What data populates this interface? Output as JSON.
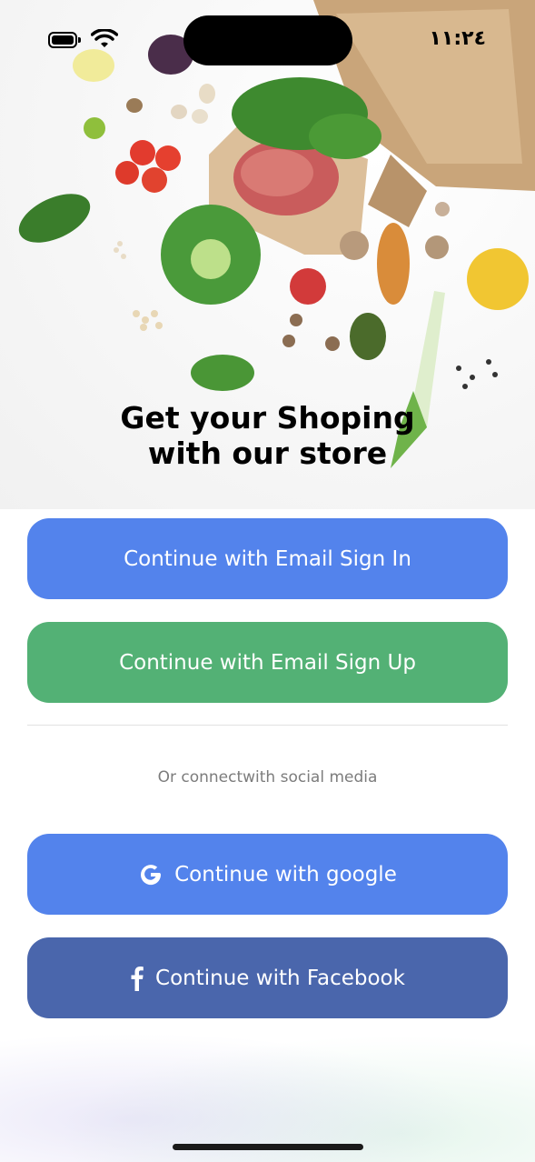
{
  "status_bar": {
    "time": "١١:٢٤"
  },
  "hero": {
    "headline_line1": "Get your Shoping",
    "headline_line2": "with our store"
  },
  "auth": {
    "signin_label": "Continue with Email Sign In",
    "signup_label": "Continue with Email Sign Up",
    "signin_color": "#5383ec",
    "signup_color": "#53b175"
  },
  "social": {
    "divider_text": "Or connectwith social media",
    "google_label": "Continue with google",
    "facebook_label": "Continue with Facebook",
    "google_icon": "google-g-icon",
    "facebook_icon": "facebook-f-icon",
    "google_color": "#5383ec",
    "facebook_color": "#4a66ac"
  }
}
